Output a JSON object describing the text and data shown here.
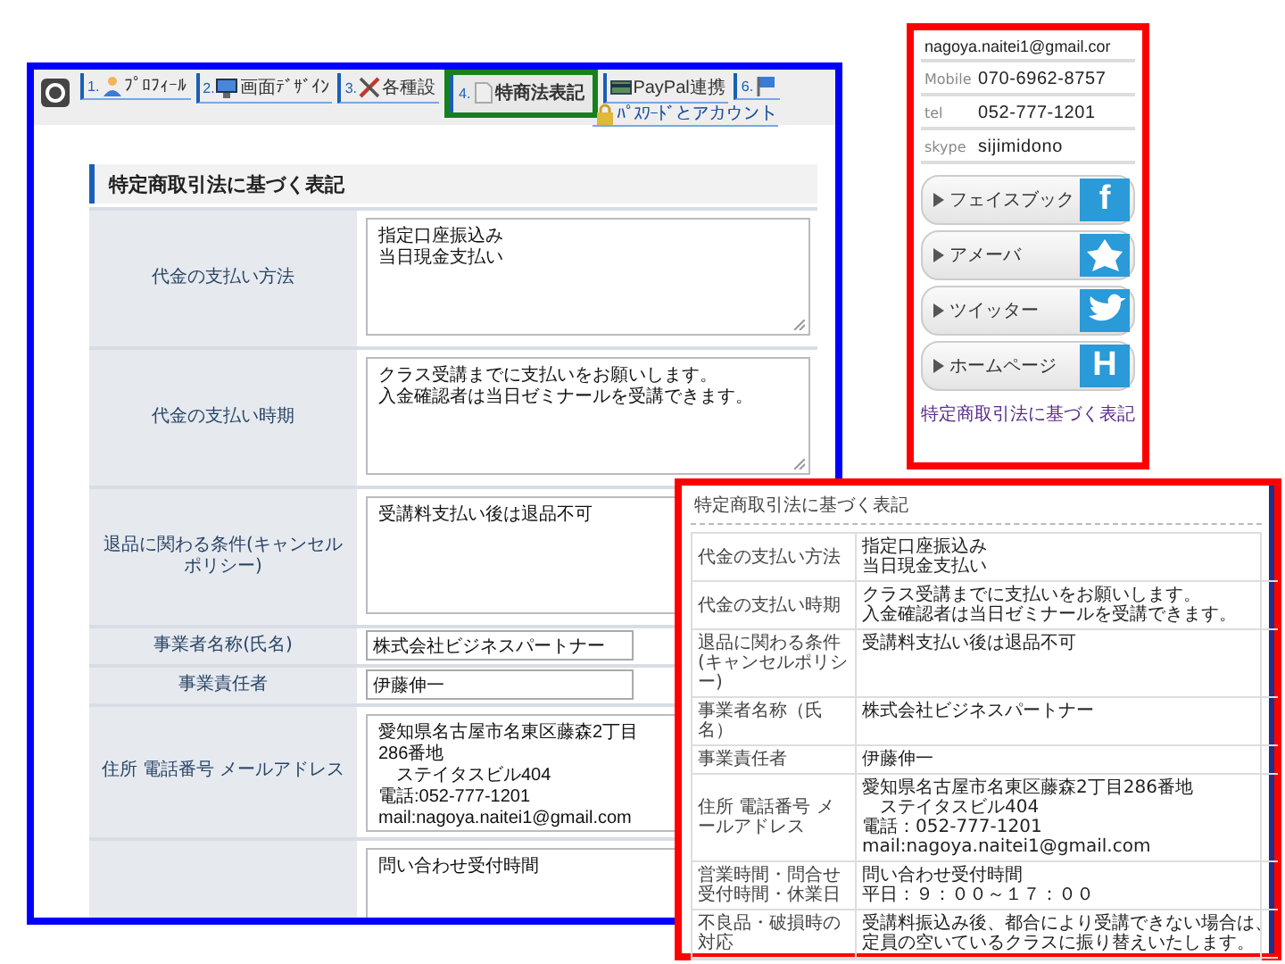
{
  "editor": {
    "tabs": [
      {
        "number": "1.",
        "label": "ﾌﾟﾛﾌｨｰﾙ",
        "kind": "person",
        "selected": false
      },
      {
        "number": "2.",
        "label": "画面ﾃﾞｻﾞｲﾝ",
        "kind": "monitor",
        "selected": false
      },
      {
        "number": "3.",
        "label": "各種設",
        "kind": "tools",
        "selected": false
      },
      {
        "number": "4.",
        "label": "特商法表記",
        "kind": "document",
        "selected": true
      },
      {
        "label": "PayPal連携",
        "kind": "card",
        "selected": false
      },
      {
        "number": "6.",
        "kind": "flag",
        "selected": false
      }
    ],
    "tabs_row_2": [
      {
        "label": "ﾊﾟｽﾜｰﾄﾞとアカウント",
        "kind": "lock",
        "selected": false
      }
    ],
    "section_title": "特定商取引法に基づく表記",
    "rows": [
      {
        "label": "代金の支払い方法",
        "kind": "textarea",
        "lines": [
          "指定口座振込み",
          "当日現金支払い"
        ]
      },
      {
        "label": "代金の支払い時期",
        "kind": "textarea",
        "lines": [
          "クラス受講までに支払いをお願いします。",
          "入金確認者は当日ゼミナールを受講できます。"
        ]
      },
      {
        "label": "退品に関わる条件(キャンセルポリシー)",
        "kind": "textarea",
        "lines": [
          "受講料支払い後は退品不可"
        ]
      },
      {
        "label": "事業者名称(氏名)",
        "kind": "input",
        "lines": [
          "株式会社ビジネスパートナー"
        ]
      },
      {
        "label": "事業責任者",
        "kind": "input",
        "lines": [
          "伊藤伸一"
        ]
      },
      {
        "label": "住所 電話番号 メールアドレス",
        "kind": "textarea",
        "lines": [
          "愛知県名古屋市名東区藤森2丁目286番地",
          "　ステイタスビル404",
          "電話:052-777-1201",
          "mail:nagoya.naitei1@gmail.com"
        ]
      },
      {
        "kind": "textarea",
        "lines": [
          "問い合わせ受付時間"
        ]
      }
    ]
  },
  "profile_card": {
    "contacts": [
      {
        "value": "nagoya.naitei1@gmail.cor"
      },
      {
        "label": "Mobile",
        "value": "070-6962-8757"
      },
      {
        "label": "tel",
        "value": "052-777-1201"
      },
      {
        "label": "skype",
        "value": "sijimidono"
      }
    ],
    "social_buttons": [
      {
        "label": "フェイスブック",
        "kind": "letter",
        "mark": "f"
      },
      {
        "label": "アメーバ",
        "kind": "figure"
      },
      {
        "label": "ツイッター",
        "kind": "bird"
      },
      {
        "label": "ホームページ",
        "kind": "letter",
        "mark": "H"
      }
    ],
    "link": "特定商取引法に基づく表記"
  },
  "preview": {
    "title": "特定商取引法に基づく表記",
    "rows": [
      {
        "label": "代金の支払い方法",
        "lines": [
          "指定口座振込み",
          "当日現金支払い"
        ]
      },
      {
        "label": "代金の支払い時期",
        "lines": [
          "クラス受講までに支払いをお願いします。",
          "入金確認者は当日ゼミナールを受講できます。"
        ]
      },
      {
        "label": "退品に関わる条件(キャンセルポリシー)",
        "lines": [
          "受講料支払い後は退品不可"
        ]
      },
      {
        "label": "事業者名称（氏名）",
        "lines": [
          "株式会社ビジネスパートナー"
        ]
      },
      {
        "label": "事業責任者",
        "lines": [
          "伊藤伸一"
        ]
      },
      {
        "label": "住所 電話番号 メールアドレス",
        "lines": [
          "愛知県名古屋市名東区藤森2丁目286番地",
          "　ステイタスビル404",
          "電話：052-777-1201",
          "mail:nagoya.naitei1@gmail.com"
        ]
      },
      {
        "label": "営業時間・問合せ受付時間・休業日",
        "lines": [
          "問い合わせ受付時間",
          "平日：９：００～１７：００"
        ]
      },
      {
        "label": "不良品・破損時の対応",
        "lines": [
          "受講料振込み後、都合により受講できない場合は、",
          "定員の空いているクラスに振り替えいたします。"
        ]
      }
    ]
  }
}
